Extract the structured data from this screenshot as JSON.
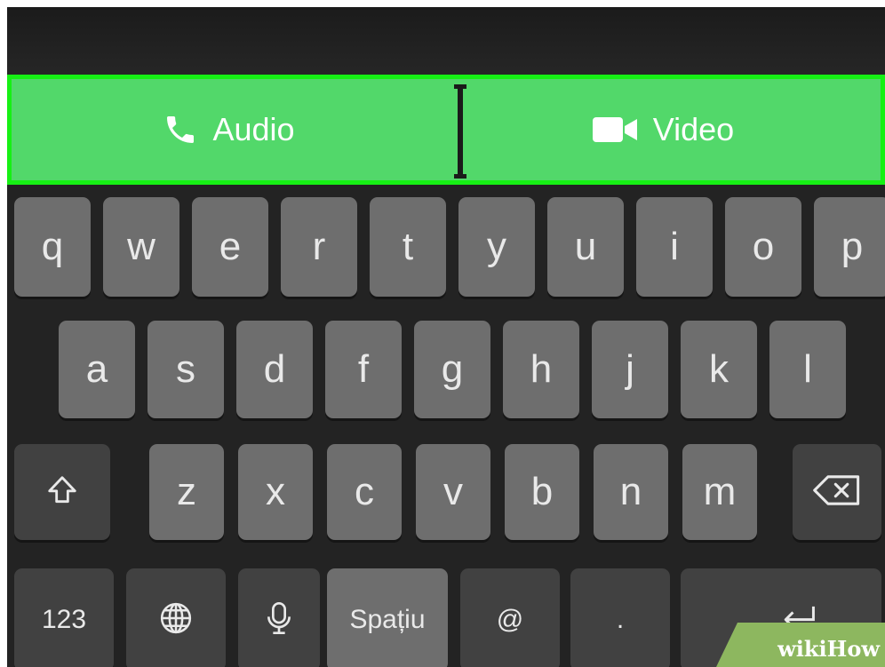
{
  "call_bar": {
    "audio_label": "Audio",
    "video_label": "Video"
  },
  "keyboard": {
    "row1": [
      "q",
      "w",
      "e",
      "r",
      "t",
      "y",
      "u",
      "i",
      "o",
      "p"
    ],
    "row2": [
      "a",
      "s",
      "d",
      "f",
      "g",
      "h",
      "j",
      "k",
      "l"
    ],
    "row3": [
      "z",
      "x",
      "c",
      "v",
      "b",
      "n",
      "m"
    ],
    "bottom": {
      "numbers_label": "123",
      "space_label": "Spațiu",
      "at_label": "@",
      "period_label": "."
    }
  },
  "watermark": {
    "wiki": "wiki",
    "how": "How"
  },
  "colors": {
    "call_green": "#52d86a",
    "highlight_border": "#16f014",
    "key_light": "#6e6e6e",
    "key_dark": "#414141"
  }
}
